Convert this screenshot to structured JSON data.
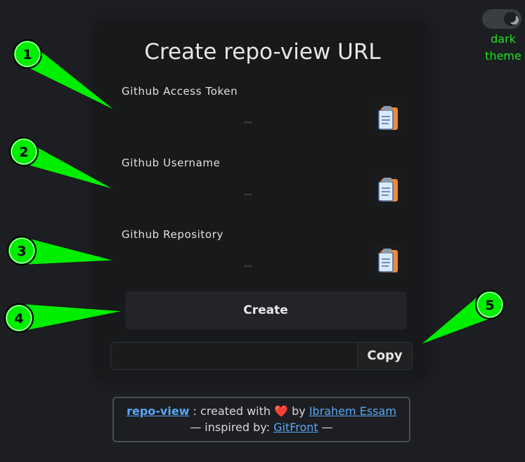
{
  "theme_toggle": {
    "label": "dark\ntheme",
    "state": "dark"
  },
  "form": {
    "title": "Create repo-view URL",
    "fields": [
      {
        "label": "Github Access Token",
        "placeholder": "...",
        "value": ""
      },
      {
        "label": "Github Username",
        "placeholder": "...",
        "value": ""
      },
      {
        "label": "Github Repository",
        "placeholder": "...",
        "value": ""
      }
    ],
    "create_label": "Create",
    "result_value": "",
    "copy_label": "Copy"
  },
  "footer": {
    "brand": "repo-view",
    "created_with": " : created with ",
    "heart": "❤️",
    "by": " by ",
    "author": "Ibrahem Essam",
    "inspired_prefix": "— inspired by: ",
    "inspired_link": "GitFront",
    "inspired_suffix": " —"
  },
  "annotations": {
    "labels": [
      "1",
      "2",
      "3",
      "4",
      "5"
    ],
    "color": "#00ee00"
  },
  "colors": {
    "background": "#1c1e21",
    "card": "#18191b",
    "accent_green": "#22e022",
    "link": "#5aa7f5"
  }
}
